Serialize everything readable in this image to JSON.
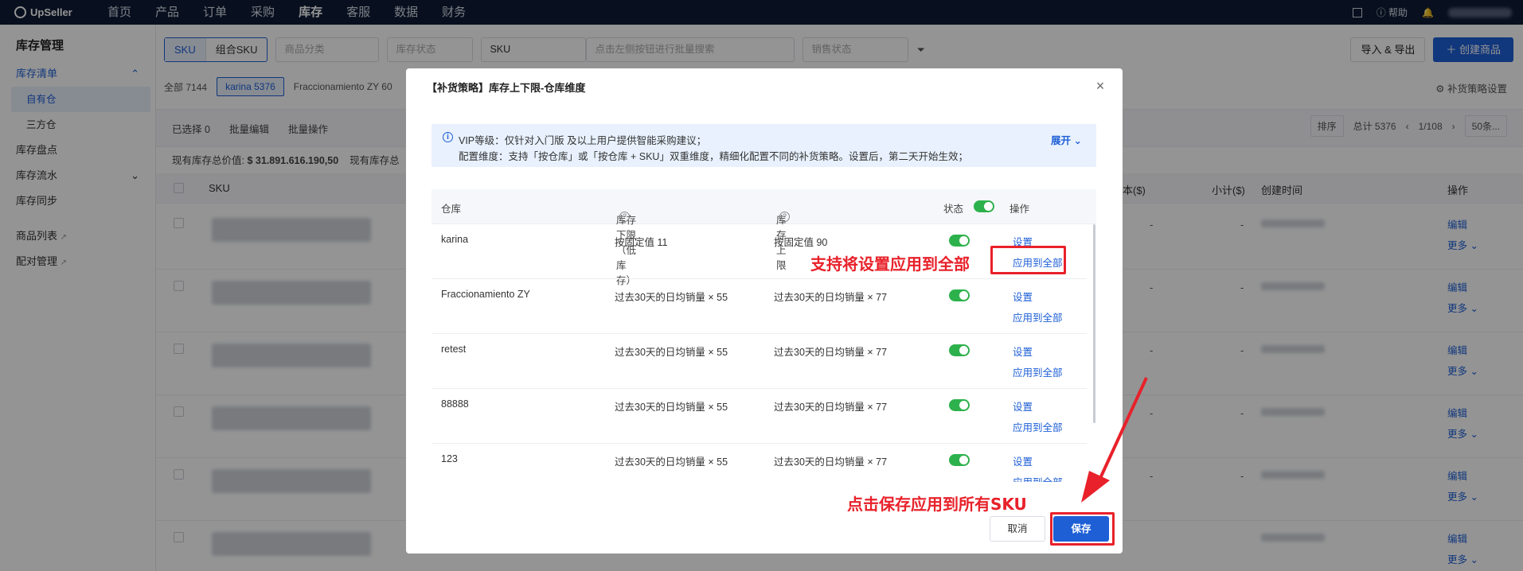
{
  "topnav": {
    "brand": "UpSeller",
    "items": [
      "首页",
      "产品",
      "订单",
      "采购",
      "库存",
      "客服",
      "数据",
      "财务"
    ],
    "active_index": 4,
    "help": "帮助"
  },
  "sidebar": {
    "title": "库存管理",
    "items": [
      {
        "label": "库存清单"
      },
      {
        "label": "自有仓"
      },
      {
        "label": "三方仓"
      },
      {
        "label": "库存盘点"
      },
      {
        "label": "库存流水"
      },
      {
        "label": "库存同步"
      },
      {
        "label": "商品列表"
      },
      {
        "label": "配对管理"
      }
    ]
  },
  "filters": {
    "seg_sku": "SKU",
    "seg_combo": "组合SKU",
    "category": "商品分类",
    "stock_status": "库存状态",
    "sku_select": "SKU",
    "search_placeholder": "点击左侧按钮进行批量搜索",
    "sale_status": "销售状态",
    "import_export": "导入 & 导出",
    "create_product": "创建商品"
  },
  "tabs": {
    "all": "全部",
    "all_count": "7144",
    "karina": "karina",
    "karina_count": "5376",
    "fracc": "Fraccionamiento ZY",
    "fracc_count": "60",
    "strategy": "补货策略设置"
  },
  "actions": {
    "selected": "已选择 0",
    "batch_edit": "批量编辑",
    "batch_ops": "批量操作",
    "sort": "排序",
    "total": "总计 5376",
    "page": "1/108",
    "per_page": "50条..."
  },
  "values_row": {
    "label": "现有库存总价值:",
    "value": "$ 31.891.616.190,50",
    "label2": "现有库存总"
  },
  "table": {
    "headers": {
      "sku": "SKU",
      "cost": "本($)",
      "subtotal": "小计($)",
      "created": "创建时间",
      "ops": "操作"
    },
    "dash": "-",
    "edit": "编辑",
    "more": "更多"
  },
  "modal": {
    "title": "【补货策略】库存上下限-仓库维度",
    "notice_line1": "VIP等级：仅针对入门版 及以上用户提供智能采购建议；",
    "notice_line2": "配置维度：支持「按仓库」或「按仓库 + SKU」双重维度，精细化配置不同的补货策略。设置后，第二天开始生效；",
    "expand": "展开",
    "columns": {
      "warehouse": "仓库",
      "min": "库存下限（低库存）",
      "max": "库存上限",
      "status": "状态",
      "ops": "操作"
    },
    "rows": [
      {
        "warehouse": "karina",
        "min": "按固定值 11",
        "max": "按固定值 90"
      },
      {
        "warehouse": "Fraccionamiento ZY",
        "min": "过去30天的日均销量 × 55",
        "max": "过去30天的日均销量 × 77"
      },
      {
        "warehouse": "retest",
        "min": "过去30天的日均销量 × 55",
        "max": "过去30天的日均销量 × 77"
      },
      {
        "warehouse": "88888",
        "min": "过去30天的日均销量 × 55",
        "max": "过去30天的日均销量 × 77"
      },
      {
        "warehouse": "123",
        "min": "过去30天的日均销量 × 55",
        "max": "过去30天的日均销量 × 77"
      }
    ],
    "set_label": "设置",
    "apply_all_label": "应用到全部",
    "cancel": "取消",
    "save": "保存"
  },
  "annotations": {
    "apply_all_note": "支持将设置应用到全部",
    "save_note": "点击保存应用到所有SKU"
  },
  "colors": {
    "accent": "#1e5fd6",
    "annotation_red": "#e8212a",
    "toggle_on": "#2db14c",
    "nav_bg": "#0f1d36"
  }
}
